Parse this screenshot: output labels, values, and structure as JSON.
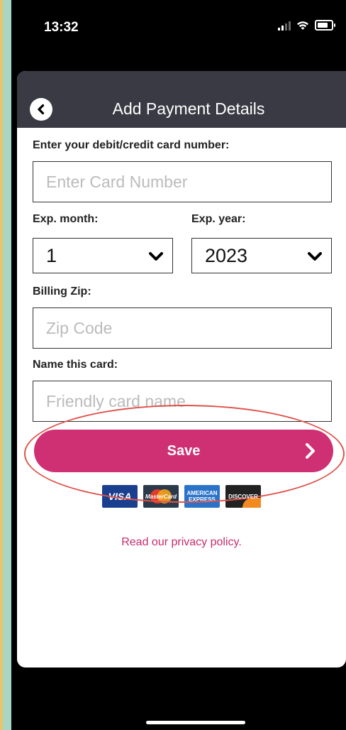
{
  "status_bar": {
    "time": "13:32"
  },
  "header": {
    "title": "Add Payment Details"
  },
  "form": {
    "card_number_label": "Enter your debit/credit card number:",
    "card_number_placeholder": "Enter Card Number",
    "exp_month_label": "Exp. month:",
    "exp_month_value": "1",
    "exp_year_label": "Exp. year:",
    "exp_year_value": "2023",
    "zip_label": "Billing Zip:",
    "zip_placeholder": "Zip Code",
    "card_name_label": "Name this card:",
    "card_name_placeholder": "Friendly card name"
  },
  "save_label": "Save",
  "card_logos": {
    "visa": "VISA",
    "mastercard": "MasterCard",
    "amex_line1": "AMERICAN",
    "amex_line2": "EXPRESS",
    "discover": "DISCOVER"
  },
  "privacy_link": "Read our privacy policy.",
  "colors": {
    "accent": "#cf2f73",
    "header_bg": "#3a3a44",
    "annotation": "#e0524a"
  }
}
